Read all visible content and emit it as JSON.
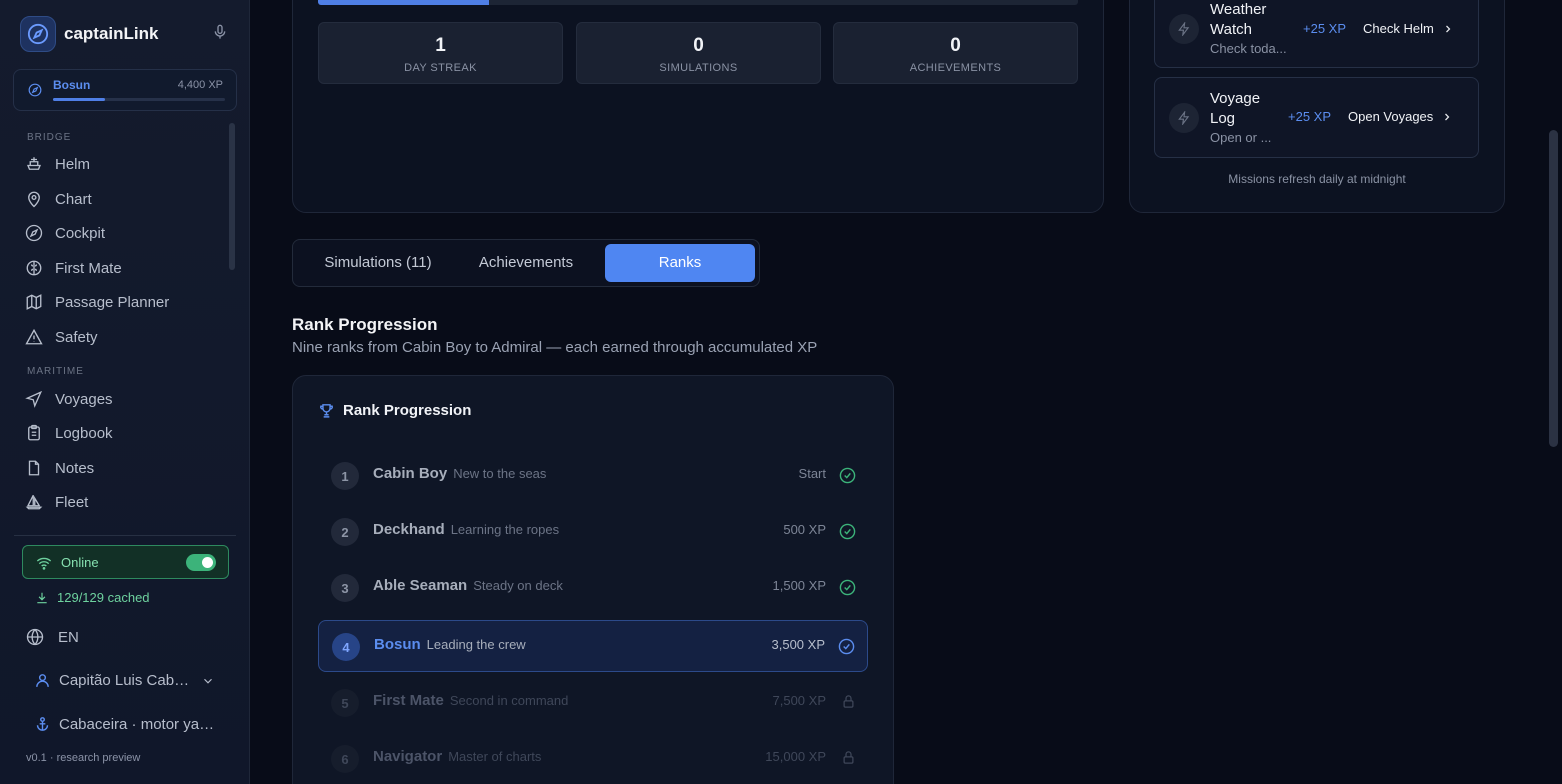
{
  "brand": {
    "name": "captainLink"
  },
  "rank_card": {
    "name": "Bosun",
    "xp": "4,400 XP",
    "progress": 0.3
  },
  "nav": {
    "bridge_label": "BRIDGE",
    "bridge_items": [
      {
        "label": "Helm",
        "icon": "ship-wheel-icon"
      },
      {
        "label": "Chart",
        "icon": "map-pin-icon"
      },
      {
        "label": "Cockpit",
        "icon": "compass-icon"
      },
      {
        "label": "First Mate",
        "icon": "brain-icon"
      },
      {
        "label": "Passage Planner",
        "icon": "map-icon"
      },
      {
        "label": "Safety",
        "icon": "warning-icon"
      }
    ],
    "maritime_label": "MARITIME",
    "maritime_items": [
      {
        "label": "Voyages",
        "icon": "navigation-icon"
      },
      {
        "label": "Logbook",
        "icon": "clipboard-icon"
      },
      {
        "label": "Notes",
        "icon": "file-icon"
      },
      {
        "label": "Fleet",
        "icon": "sailboat-icon"
      }
    ]
  },
  "status": {
    "online_label": "Online",
    "online_on": true,
    "cached": "129/129 cached"
  },
  "language": "EN",
  "user": {
    "name": "Capitão Luis Cabaceira"
  },
  "vessel": {
    "name": "Cabaceira · motor yacht"
  },
  "version": "v0.1 · research preview",
  "stats": [
    {
      "value": "1",
      "label": "DAY STREAK"
    },
    {
      "value": "0",
      "label": "SIMULATIONS"
    },
    {
      "value": "0",
      "label": "ACHIEVEMENTS"
    }
  ],
  "top_progress": 0.225,
  "missions": [
    {
      "title": "Weather Watch",
      "desc": "Check toda...",
      "xp": "+25 XP",
      "action": "Check Helm"
    },
    {
      "title": "Voyage Log",
      "desc": "Open or ...",
      "xp": "+25 XP",
      "action": "Open Voyages"
    }
  ],
  "missions_note": "Missions refresh daily at midnight",
  "tabs": [
    {
      "label": "Simulations (11)",
      "active": false
    },
    {
      "label": "Achievements",
      "active": false
    },
    {
      "label": "Ranks",
      "active": true
    }
  ],
  "rank_section": {
    "title": "Rank Progression",
    "subtitle": "Nine ranks from Cabin Boy to Admiral — each earned through accumulated XP",
    "panel_title": "Rank Progression",
    "ranks": [
      {
        "num": "1",
        "name": "Cabin Boy",
        "desc": "New to the seas",
        "xp": "Start",
        "state": "done"
      },
      {
        "num": "2",
        "name": "Deckhand",
        "desc": "Learning the ropes",
        "xp": "500 XP",
        "state": "done"
      },
      {
        "num": "3",
        "name": "Able Seaman",
        "desc": "Steady on deck",
        "xp": "1,500 XP",
        "state": "done"
      },
      {
        "num": "4",
        "name": "Bosun",
        "desc": "Leading the crew",
        "xp": "3,500 XP",
        "state": "current"
      },
      {
        "num": "5",
        "name": "First Mate",
        "desc": "Second in command",
        "xp": "7,500 XP",
        "state": "locked"
      },
      {
        "num": "6",
        "name": "Navigator",
        "desc": "Master of charts",
        "xp": "15,000 XP",
        "state": "locked"
      }
    ]
  },
  "colors": {
    "accent": "#4f86f2",
    "success": "#3cb37a",
    "background": "#080c18"
  }
}
